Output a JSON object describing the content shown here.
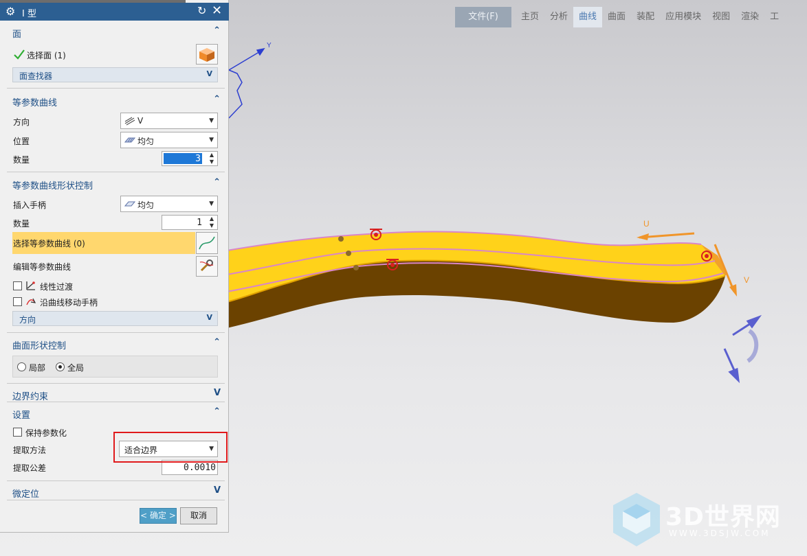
{
  "dialog": {
    "title": "I 型",
    "sections": {
      "face": {
        "label": "面"
      },
      "iso_curve": {
        "label": "等参数曲线"
      },
      "iso_shape": {
        "label": "等参数曲线形状控制"
      },
      "surface_shape": {
        "label": "曲面形状控制"
      },
      "boundary": {
        "label": "边界约束"
      },
      "settings": {
        "label": "设置"
      },
      "micro": {
        "label": "微定位"
      }
    },
    "face": {
      "select_label": "选择面 (1)",
      "finder_label": "面查找器"
    },
    "iso_curve": {
      "direction_label": "方向",
      "direction_value": "V",
      "position_label": "位置",
      "position_value": "均匀",
      "count_label": "数量",
      "count_value": "3"
    },
    "iso_shape": {
      "handle_label": "插入手柄",
      "handle_value": "均匀",
      "count_label": "数量",
      "count_value": "1",
      "select_curve_label": "选择等参数曲线 (0)",
      "edit_curve_label": "编辑等参数曲线",
      "linear_label": "线性过渡",
      "move_handle_label": "沿曲线移动手柄",
      "direction_finder_label": "方向"
    },
    "surface_shape": {
      "local_label": "局部",
      "global_label": "全局"
    },
    "settings": {
      "keep_param_label": "保持参数化",
      "extract_method_label": "提取方法",
      "extract_method_value": "适合边界",
      "tolerance_label": "提取公差",
      "tolerance_value": "0.0010"
    },
    "ok_label": "< 确定 >",
    "cancel_label": "取消"
  },
  "ribbon": {
    "tabs": [
      "文件(F)",
      "主页",
      "分析",
      "曲线",
      "曲面",
      "装配",
      "应用模块",
      "视图",
      "渲染",
      "工"
    ],
    "active": "曲线"
  },
  "viewport": {
    "axis_y": "Y",
    "label_u": "U",
    "label_v": "V"
  },
  "watermark": {
    "brand": "3D世界网",
    "url": "WWW.3DSJW.COM"
  },
  "colors": {
    "title_bar": "#2c5f92",
    "accent": "#1e4f86",
    "highlight_row": "#ffd76e",
    "surface": "#ffd21a",
    "surface_side": "#6e4300",
    "ok_button": "#4f9fc7"
  }
}
